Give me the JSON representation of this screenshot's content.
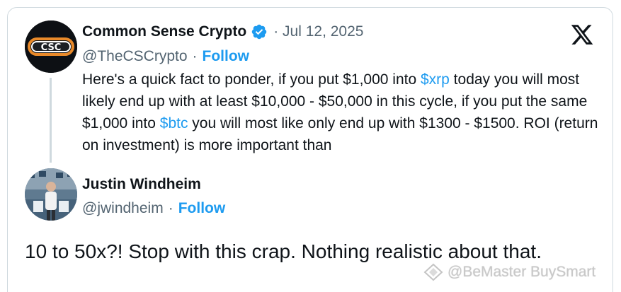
{
  "parent_tweet": {
    "display_name": "Common Sense Crypto",
    "date": "Jul 12, 2025",
    "date_separator": "·",
    "handle": "@TheCSCrypto",
    "handle_separator": "·",
    "follow_label": "Follow",
    "avatar_text": "CSC",
    "text_segments": [
      {
        "text": "Here's a quick fact to ponder, if you put $1,000 into ",
        "cashtag": false
      },
      {
        "text": "$xrp",
        "cashtag": true
      },
      {
        "text": " today you will most likely end up with at least $10,000 - $50,000 in this cycle, if you put the same $1,000 into ",
        "cashtag": false
      },
      {
        "text": "$btc",
        "cashtag": true
      },
      {
        "text": " you will most like only end up with $1300 - $1500. ROI (return on investment) is more important than",
        "cashtag": false
      }
    ]
  },
  "reply_tweet": {
    "display_name": "Justin Windheim",
    "handle": "@jwindheim",
    "handle_separator": "·",
    "follow_label": "Follow",
    "text": "10 to 50x?! Stop with this crap. Nothing realistic about that."
  },
  "watermark": {
    "text": "@BeMaster BuySmart"
  },
  "colors": {
    "link_blue": "#1d9bf0",
    "text_primary": "#0f1419",
    "text_secondary": "#536471",
    "border": "#cfd9de"
  },
  "icons": [
    "x-logo-icon",
    "verified-badge-icon",
    "watermark-logo-icon"
  ]
}
